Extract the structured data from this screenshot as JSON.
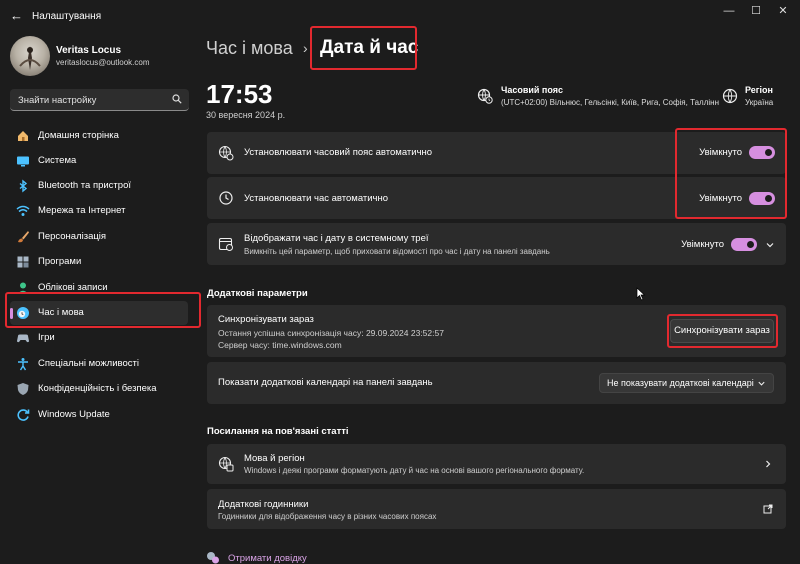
{
  "window": {
    "title": "Налаштування",
    "back_glyph": "←",
    "minimize_glyph": "—",
    "maximize_glyph": "☐",
    "close_glyph": "✕"
  },
  "profile": {
    "name": "Veritas Locus",
    "email": "veritaslocus@outlook.com"
  },
  "search": {
    "placeholder": "Знайти настройку"
  },
  "sidebar": {
    "items": [
      {
        "label": "Домашня сторінка",
        "icon": "home-icon"
      },
      {
        "label": "Система",
        "icon": "monitor-icon"
      },
      {
        "label": "Bluetooth та пристрої",
        "icon": "bluetooth-icon"
      },
      {
        "label": "Мережа та Інтернет",
        "icon": "wifi-icon"
      },
      {
        "label": "Персоналізація",
        "icon": "brush-icon"
      },
      {
        "label": "Програми",
        "icon": "apps-icon"
      },
      {
        "label": "Облікові записи",
        "icon": "account-icon"
      },
      {
        "label": "Час і мова",
        "icon": "time-language-icon",
        "selected": true
      },
      {
        "label": "Ігри",
        "icon": "gamepad-icon"
      },
      {
        "label": "Спеціальні можливості",
        "icon": "accessibility-icon"
      },
      {
        "label": "Конфіденційність і безпека",
        "icon": "shield-icon"
      },
      {
        "label": "Windows Update",
        "icon": "update-icon"
      }
    ]
  },
  "breadcrumb": {
    "parent": "Час і мова",
    "separator": "›",
    "current": "Дата й час"
  },
  "clock": {
    "time": "17:53",
    "date": "30 вересня 2024 р."
  },
  "timezone": {
    "title": "Часовий пояс",
    "value": "(UTC+02:00) Вільнюс, Гельсінкі, Київ, Рига, Софія, Таллінн"
  },
  "region": {
    "title": "Регіон",
    "value": "Україна"
  },
  "settings": {
    "auto_timezone": {
      "label": "Установлювати часовий пояс автоматично",
      "state": "Увімкнуто",
      "on": true
    },
    "auto_time": {
      "label": "Установлювати час автоматично",
      "state": "Увімкнуто",
      "on": true
    },
    "show_tray": {
      "label": "Відображати час і дату в системному треї",
      "desc": "Вимкніть цей параметр, щоб приховати відомості про час і дату на панелі завдань",
      "state": "Увімкнуто",
      "on": true
    }
  },
  "additional": {
    "heading": "Додаткові параметри",
    "sync": {
      "title": "Синхронізувати зараз",
      "last_sync": "Остання успішна синхронізація часу: 29.09.2024 23:52:57",
      "server": "Сервер часу: time.windows.com",
      "button": "Синхронізувати зараз"
    },
    "calendars": {
      "label": "Показати додаткові календарі на панелі завдань",
      "selected": "Не показувати додаткові календарі"
    }
  },
  "related": {
    "heading": "Посилання на пов'язані статті",
    "language_region": {
      "title": "Мова й регіон",
      "desc": "Windows і деякі програми форматують дату й час на основі вашого регіонального формату."
    },
    "extra_clocks": {
      "title": "Додаткові годинники",
      "desc": "Годинники для відображення часу в різних часових поясах"
    }
  },
  "help": {
    "label": "Отримати довідку"
  },
  "colors": {
    "background": "#1c1c1c",
    "card": "#2b2b2b",
    "accent": "#d68fe0",
    "highlight": "#e2292f"
  }
}
